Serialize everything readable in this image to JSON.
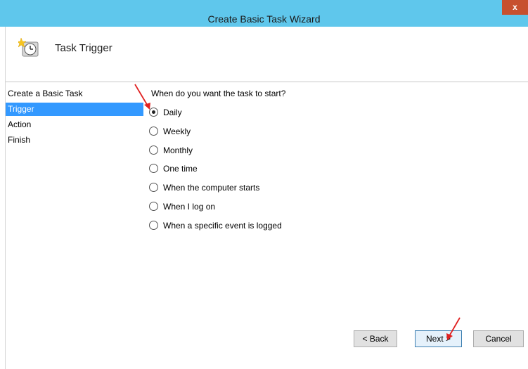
{
  "window": {
    "title": "Create Basic Task Wizard",
    "close_label": "x"
  },
  "header": {
    "title": "Task Trigger"
  },
  "steps": [
    {
      "label": "Create a Basic Task",
      "active": false
    },
    {
      "label": "Trigger",
      "active": true
    },
    {
      "label": "Action",
      "active": false
    },
    {
      "label": "Finish",
      "active": false
    }
  ],
  "trigger": {
    "question": "When do you want the task to start?",
    "selected": "Daily",
    "options": [
      {
        "label": "Daily",
        "checked": true
      },
      {
        "label": "Weekly",
        "checked": false
      },
      {
        "label": "Monthly",
        "checked": false
      },
      {
        "label": "One time",
        "checked": false
      },
      {
        "label": "When the computer starts",
        "checked": false
      },
      {
        "label": "When I log on",
        "checked": false
      },
      {
        "label": "When a specific event is logged",
        "checked": false
      }
    ]
  },
  "buttons": {
    "back": "< Back",
    "next": "Next >",
    "cancel": "Cancel"
  },
  "colors": {
    "titlebar": "#5fc7ec",
    "selection": "#3399ff",
    "close": "#c7502e",
    "annotation_arrow": "#e02020"
  },
  "icons": {
    "header": "task-scheduler-clock-icon"
  }
}
